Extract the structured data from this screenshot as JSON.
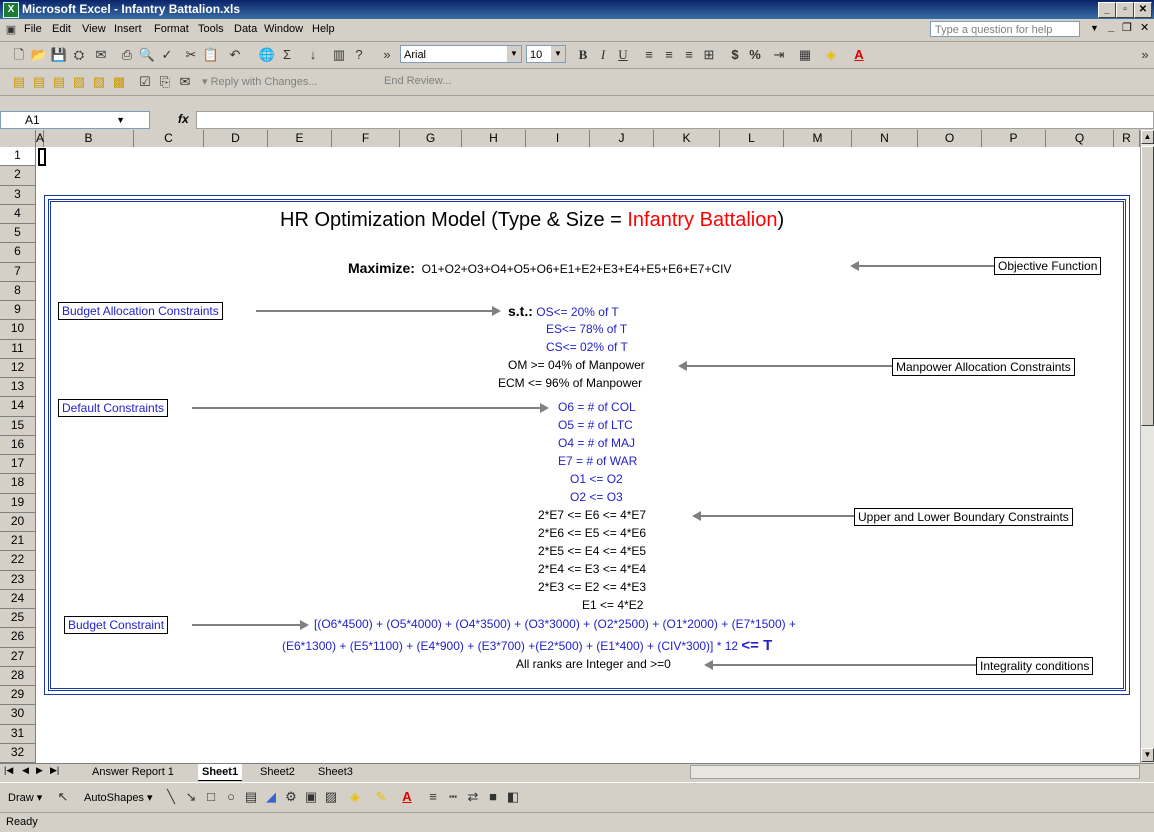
{
  "window": {
    "title": "Microsoft Excel - Infantry Battalion.xls"
  },
  "menu": {
    "items": [
      "File",
      "Edit",
      "View",
      "Insert",
      "Format",
      "Tools",
      "Data",
      "Window",
      "Help"
    ],
    "help_placeholder": "Type a question for help"
  },
  "toolbar": {
    "font_name": "Arial",
    "font_size": "10",
    "review_reply": "Reply with Changes...",
    "review_end": "End Review..."
  },
  "formula_bar": {
    "cell_ref": "A1",
    "fx_label": "fx",
    "content": ""
  },
  "columns": [
    "A",
    "B",
    "C",
    "D",
    "E",
    "F",
    "G",
    "H",
    "I",
    "J",
    "K",
    "L",
    "M",
    "N",
    "O",
    "P",
    "Q",
    "R"
  ],
  "rows": [
    "1",
    "2",
    "3",
    "4",
    "5",
    "6",
    "7",
    "8",
    "9",
    "10",
    "11",
    "12",
    "13",
    "14",
    "15",
    "16",
    "17",
    "18",
    "19",
    "20",
    "21",
    "22",
    "23",
    "24",
    "25",
    "26",
    "27",
    "28",
    "29",
    "30",
    "31",
    "32"
  ],
  "model": {
    "title_prefix": "HR Optimization Model (Type & Size = ",
    "title_highlight": "Infantry Battalion",
    "title_suffix": ")",
    "maximize_label": "Maximize:",
    "objective": "O1+O2+O3+O4+O5+O6+E1+E2+E3+E4+E5+E6+E7+CIV",
    "st_label": "s.t.:",
    "budget_alloc": [
      "OS<= 20% of  T",
      "ES<= 78% of  T",
      "CS<= 02% of  T"
    ],
    "manpower_alloc": [
      "OM >= 04% of Manpower",
      "ECM <= 96% of Manpower"
    ],
    "defaults": [
      "O6 = # of COL",
      "O5 = # of LTC",
      "O4 = # of MAJ",
      "E7 = # of WAR",
      "O1 <= O2",
      "O2 <= O3"
    ],
    "boundary": [
      "2*E7 <= E6 <= 4*E7",
      "2*E6 <= E5 <= 4*E6",
      "2*E5 <= E4 <= 4*E5",
      "2*E4 <= E3 <= 4*E4",
      "2*E3 <= E2 <= 4*E3",
      "E1 <= 4*E2"
    ],
    "budget_line1": "[(O6*4500) + (O5*4000) +  (O4*3500) + (O3*3000) + (O2*2500) + (O1*2000) + (E7*1500) +",
    "budget_line2": "(E6*1300) + (E5*1100) + (E4*900) + (E3*700) +(E2*500) + (E1*400) + (CIV*300)] * 12",
    "budget_le_t": "<= T",
    "integrality": "All ranks are Integer and >=0"
  },
  "callouts": {
    "objective_function": "Objective Function",
    "budget_allocation": "Budget Allocation Constraints",
    "manpower_allocation": "Manpower Allocation Constraints",
    "default_constraints": "Default Constraints",
    "boundary_constraints": "Upper and Lower Boundary Constraints",
    "budget_constraint": "Budget Constraint",
    "integrality_conditions": "Integrality conditions"
  },
  "sheet_tabs": [
    "Answer Report 1",
    "Sheet1",
    "Sheet2",
    "Sheet3"
  ],
  "active_tab": "Sheet1",
  "draw_toolbar": {
    "draw": "Draw",
    "autoshapes": "AutoShapes"
  },
  "status": {
    "text": "Ready"
  },
  "colors": {
    "accent_red": "#ff0000",
    "constraint_blue": "#2222cc",
    "border_blue": "#1a3aa0"
  }
}
